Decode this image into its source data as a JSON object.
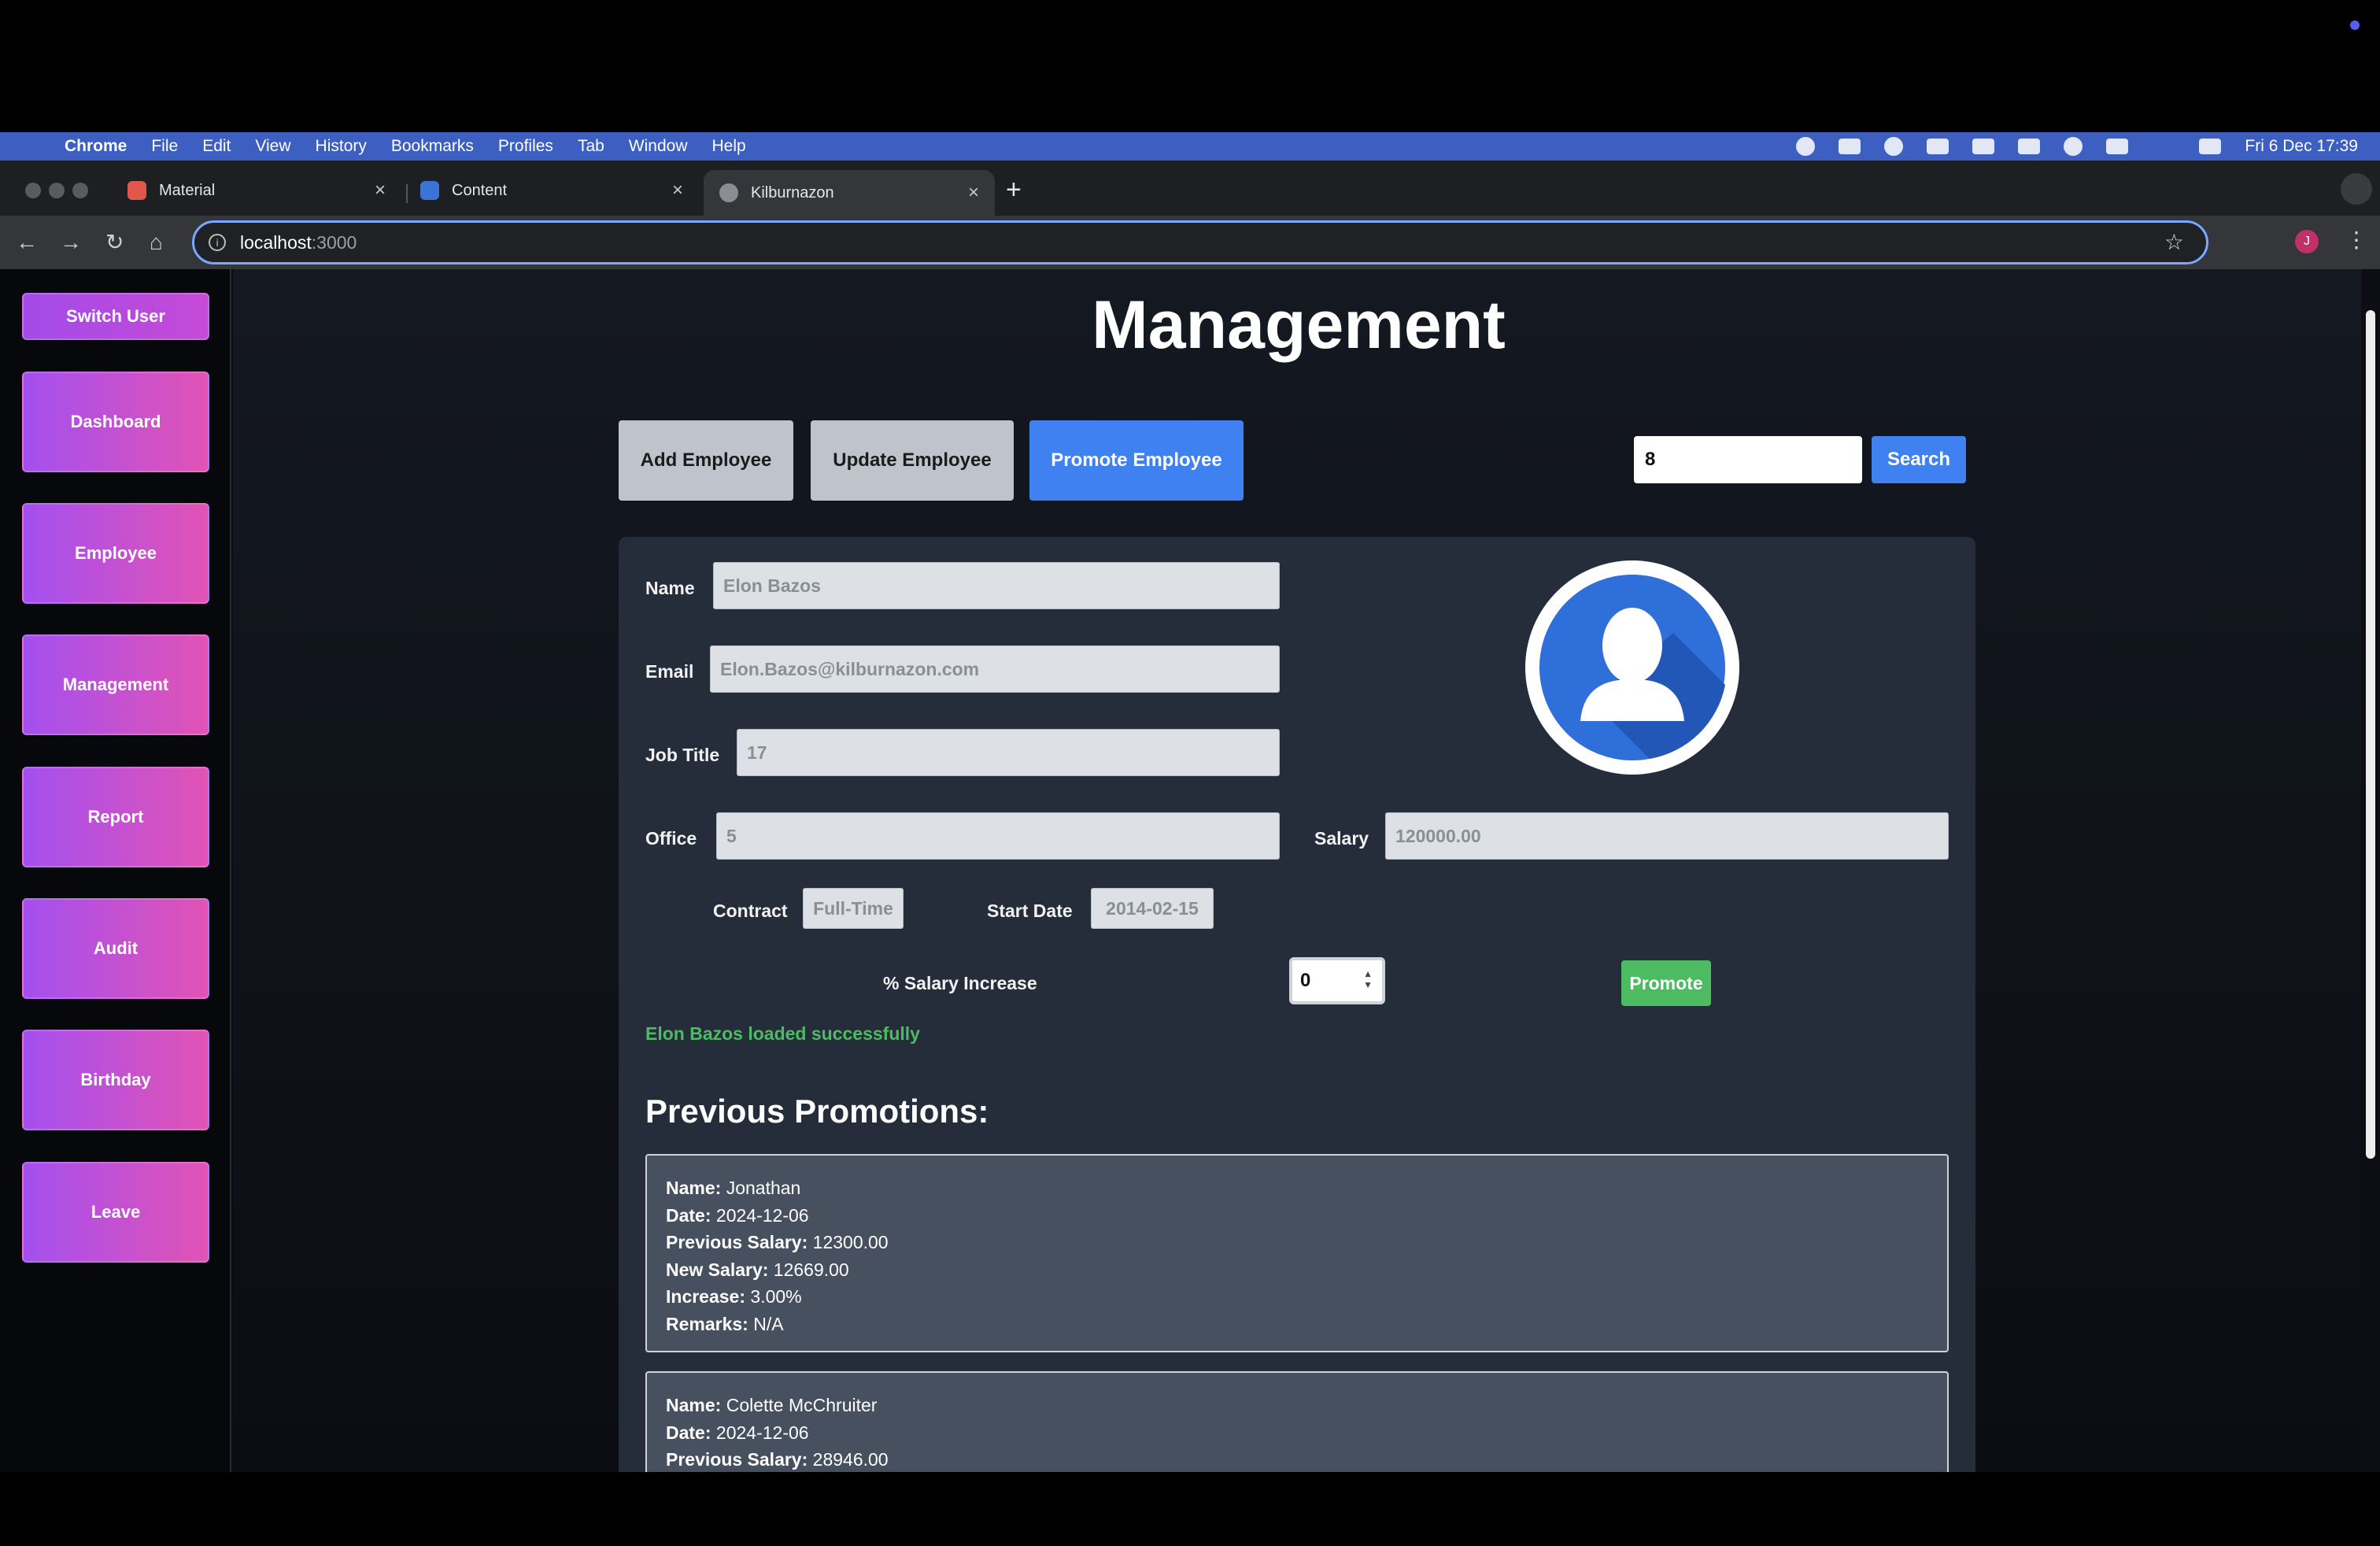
{
  "menubar": {
    "app": "Chrome",
    "items": [
      "File",
      "Edit",
      "View",
      "History",
      "Bookmarks",
      "Profiles",
      "Tab",
      "Window",
      "Help"
    ],
    "clock": "Fri 6 Dec  17:39"
  },
  "tabs": [
    {
      "label": "Material",
      "active": false
    },
    {
      "label": "Content",
      "active": false
    },
    {
      "label": "Kilburnazon",
      "active": true
    }
  ],
  "address": {
    "host": "localhost",
    "port": ":3000"
  },
  "sidebar": {
    "switch_user": "Switch User",
    "items": [
      "Dashboard",
      "Employee",
      "Management",
      "Report",
      "Audit",
      "Birthday",
      "Leave"
    ]
  },
  "page": {
    "title": "Management",
    "actions": {
      "add": "Add Employee",
      "update": "Update Employee",
      "promote": "Promote Employee"
    },
    "search": {
      "value": "8",
      "button": "Search"
    }
  },
  "form": {
    "name_label": "Name",
    "name": "Elon Bazos",
    "email_label": "Email",
    "email": "Elon.Bazos@kilburnazon.com",
    "job_label": "Job Title",
    "job": "17",
    "office_label": "Office",
    "office": "5",
    "salary_label": "Salary",
    "salary": "120000.00",
    "contract_label": "Contract",
    "contract": "Full-Time",
    "start_label": "Start Date",
    "start": "2014-02-15",
    "increase_label": "% Salary Increase",
    "increase": "0",
    "promote_button": "Promote",
    "status": "Elon Bazos loaded successfully"
  },
  "promotions": {
    "heading": "Previous Promotions:",
    "labels": {
      "name": "Name:",
      "date": "Date:",
      "prev": "Previous Salary:",
      "new": "New Salary:",
      "inc": "Increase:",
      "rem": "Remarks:"
    },
    "items": [
      {
        "name": "Jonathan",
        "date": "2024-12-06",
        "prev": "12300.00",
        "new": "12669.00",
        "inc": "3.00%",
        "rem": "N/A"
      },
      {
        "name": "Colette McChruiter",
        "date": "2024-12-06",
        "prev": "28946.00"
      }
    ]
  },
  "colors": {
    "menubar": "#3c5fc1",
    "accent_blue": "#3f81f1",
    "success": "#4cbb61",
    "sidebar_gradient_start": "#a44ff0",
    "sidebar_gradient_end": "#e253b5"
  }
}
